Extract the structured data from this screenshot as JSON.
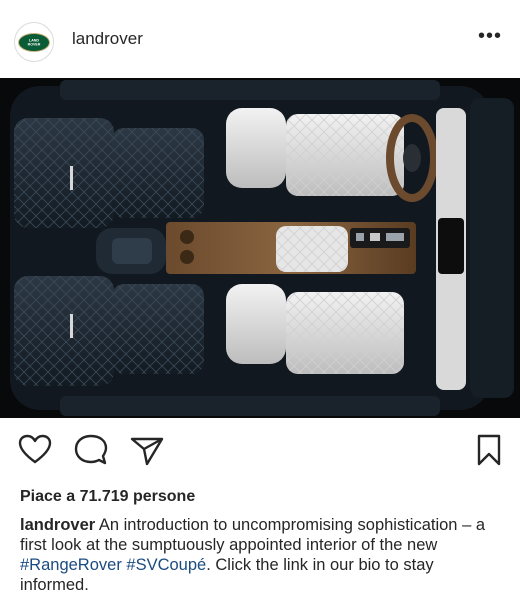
{
  "post": {
    "username": "landrover",
    "avatar_logo": "LAND ROVER",
    "more_icon": "more-horizontal-icon",
    "likes_text": "Piace a 71.719 persone",
    "caption": {
      "username": "landrover",
      "text_part1": " An introduction to uncompromising sophistication – a first look at the sumptuously appointed interior of the new ",
      "hashtag1": "#RangeRover",
      "text_part2": " ",
      "hashtag2": "#SVCoupé",
      "text_part3": ". Click the link in our bio to stay informed."
    },
    "actions": {
      "like_icon": "heart-icon",
      "comment_icon": "comment-icon",
      "share_icon": "paper-plane-icon",
      "save_icon": "bookmark-icon"
    }
  },
  "colors": {
    "brand_green": "#0a5c36",
    "hashtag": "#1b4b80",
    "text": "#262626"
  }
}
